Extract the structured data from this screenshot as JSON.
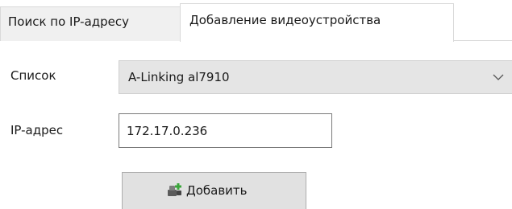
{
  "tabs": [
    {
      "label": "Поиск по IP-адресу",
      "active": false
    },
    {
      "label": "Добавление видеоустройства",
      "active": true
    }
  ],
  "form": {
    "list_label": "Список",
    "list_value": "A-Linking al7910",
    "ip_label": "IP-адрес",
    "ip_value": "172.17.0.236"
  },
  "add_button": {
    "label": "Добавить",
    "icon": "add-device-icon"
  },
  "colors": {
    "combo_background": "#e5e5e5",
    "button_background": "#e1e1e1",
    "inactive_tab_background": "#f0f0f0",
    "icon_green": "#3aa63a"
  }
}
